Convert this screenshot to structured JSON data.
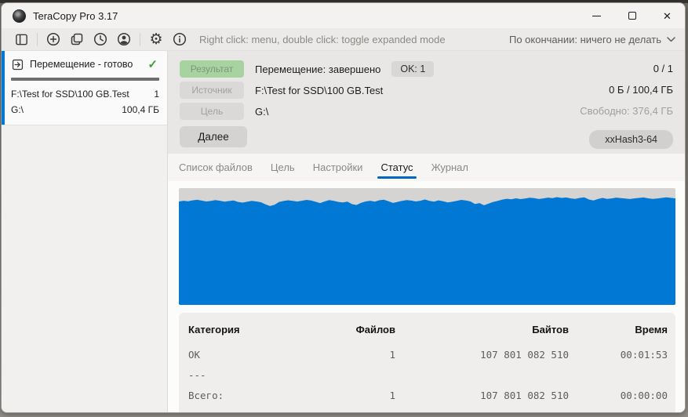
{
  "window": {
    "title": "TeraCopy Pro 3.17"
  },
  "toolbar": {
    "hint": "Right click: menu, double click: toggle expanded mode",
    "on_finish": "По окончании: ничего не делать"
  },
  "sidebar": {
    "task": {
      "title": "Перемещение - готово",
      "source_path": "F:\\Test for SSD\\100 GB.Test",
      "files_count": "1",
      "target_path": "G:\\",
      "size": "100,4 ГБ"
    }
  },
  "info": {
    "result_label": "Результат",
    "result_text": "Перемещение: завершено",
    "ok_badge": "OK: 1",
    "source_label": "Источник",
    "source_value": "F:\\Test for SSD\\100 GB.Test",
    "target_label": "Цель",
    "target_value": "G:\\",
    "next_button": "Далее",
    "progress_count": "0 / 1",
    "progress_bytes": "0 Б / 100,4 ГБ",
    "free_space": "Свободно: 376,4 ГБ",
    "hash_button": "xxHash3-64"
  },
  "tabs": [
    {
      "label": "Список файлов",
      "active": false
    },
    {
      "label": "Цель",
      "active": false
    },
    {
      "label": "Настройки",
      "active": false
    },
    {
      "label": "Статус",
      "active": true
    },
    {
      "label": "Журнал",
      "active": false
    }
  ],
  "chart_data": {
    "type": "area",
    "title": "",
    "xlabel": "",
    "ylabel": "",
    "legend": false,
    "grid": false,
    "axes_visible": false,
    "color": "#0078d4",
    "background": "#d6d4d2",
    "ylim": [
      0,
      100
    ],
    "values": [
      88.5,
      89.2,
      88.8,
      89.5,
      90,
      89.3,
      88.6,
      89,
      89.8,
      89.2,
      88.4,
      88.9,
      89.4,
      88.2,
      87.6,
      88.3,
      89.1,
      88.6,
      87.9,
      86.2,
      84.6,
      85.8,
      88.2,
      89,
      89.6,
      89.1,
      88.5,
      89.2,
      89.9,
      89.4,
      88.3,
      87.2,
      88.6,
      89.8,
      89.1,
      88.2,
      87.7,
      88.4,
      86.3,
      85.6,
      87.4,
      88.6,
      89.2,
      88.4,
      89.6,
      90.1,
      88.7,
      87.3,
      88.2,
      89.1,
      89.8,
      89.3,
      88.6,
      89.2,
      90.3,
      89.1,
      88.4,
      89.5,
      88.7,
      87.8,
      88.3,
      89.1,
      89.9,
      89.4,
      88.6,
      86.4,
      87.2,
      85.3,
      86.8,
      88.2,
      89.1,
      90.2,
      90.9,
      90.4,
      91.3,
      90.6,
      91.1,
      91.8,
      91.4,
      90.7,
      91.2,
      91.9,
      91.5,
      92.3,
      91.6,
      92,
      91.2,
      90.8,
      91.6,
      92.1,
      90.3,
      89.4,
      90.7,
      91.6,
      90.8,
      91.2,
      91.9,
      91.5,
      91.1,
      90.7,
      91.2,
      91.6,
      92,
      91.3,
      90.8,
      91.1,
      91.6,
      92.1,
      91.7,
      91.2
    ]
  },
  "stats": {
    "headers": [
      "Категория",
      "Файлов",
      "Байтов",
      "Время"
    ],
    "rows": [
      {
        "category": "OK",
        "files": "1",
        "bytes": "107 801 082 510",
        "time": "00:01:53"
      },
      {
        "category": "---",
        "files": "",
        "bytes": "",
        "time": ""
      },
      {
        "category": "Всего:",
        "files": "1",
        "bytes": "107 801 082 510",
        "time": "00:00:00"
      }
    ]
  }
}
